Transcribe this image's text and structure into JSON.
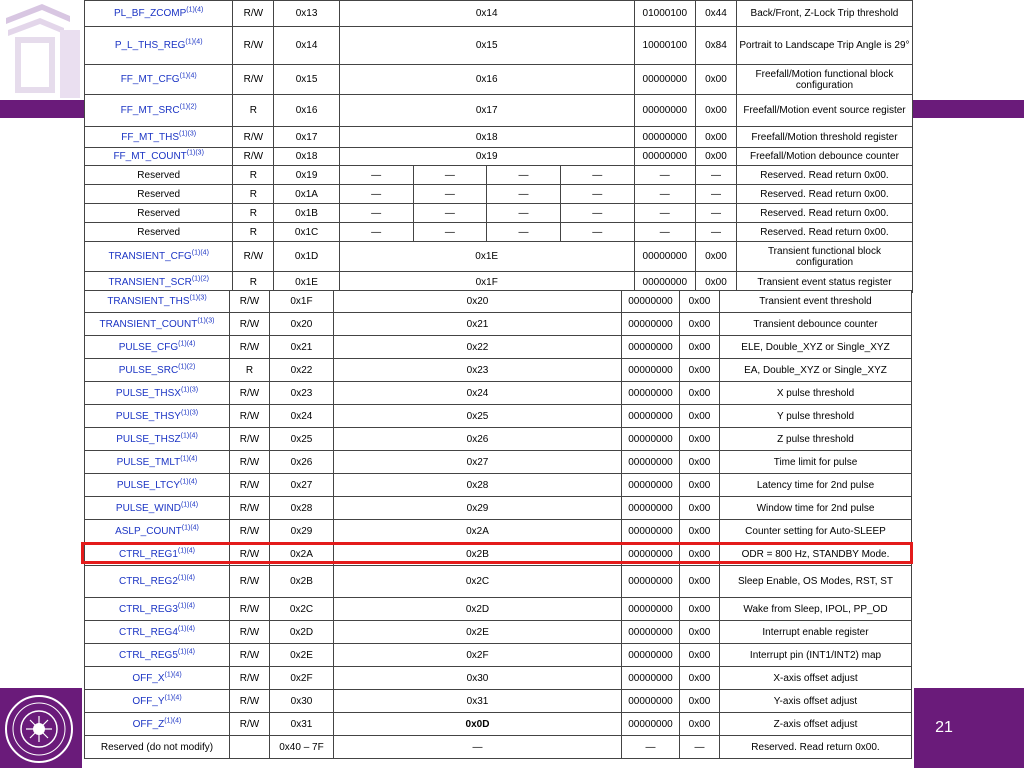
{
  "page_number": "21",
  "table_top": {
    "rows": [
      {
        "name": "PL_BF_ZCOMP",
        "note": "(1)(4)",
        "rw": "R/W",
        "addr": "0x13",
        "auto": [
          "0x14"
        ],
        "default": "01000100",
        "hex": "0x44",
        "comment": "Back/Front, Z-Lock Trip threshold"
      },
      {
        "name": "P_L_THS_REG",
        "note": "(1)(4)",
        "rw": "R/W",
        "addr": "0x14",
        "auto": [
          "0x15"
        ],
        "default": "10000100",
        "hex": "0x84",
        "comment": "Portrait to Landscape Trip Angle is 29°"
      },
      {
        "name": "FF_MT_CFG",
        "note": "(1)(4)",
        "rw": "R/W",
        "addr": "0x15",
        "auto": [
          "0x16"
        ],
        "default": "00000000",
        "hex": "0x00",
        "comment": "Freefall/Motion functional block configuration"
      },
      {
        "name": "FF_MT_SRC",
        "note": "(1)(2)",
        "rw": "R",
        "addr": "0x16",
        "auto": [
          "0x17"
        ],
        "default": "00000000",
        "hex": "0x00",
        "comment": "Freefall/Motion event source register"
      },
      {
        "name": "FF_MT_THS",
        "note": "(1)(3)",
        "rw": "R/W",
        "addr": "0x17",
        "auto": [
          "0x18"
        ],
        "default": "00000000",
        "hex": "0x00",
        "comment": "Freefall/Motion threshold register"
      },
      {
        "name": "FF_MT_COUNT",
        "note": "(1)(3)",
        "rw": "R/W",
        "addr": "0x18",
        "auto": [
          "0x19"
        ],
        "default": "00000000",
        "hex": "0x00",
        "comment": "Freefall/Motion debounce counter"
      },
      {
        "name": "Reserved",
        "note": "",
        "rw": "R",
        "addr": "0x19",
        "auto": [
          "—",
          "—",
          "—",
          "—"
        ],
        "default": "—",
        "hex": "—",
        "comment": "Reserved. Read return 0x00."
      },
      {
        "name": "Reserved",
        "note": "",
        "rw": "R",
        "addr": "0x1A",
        "auto": [
          "—",
          "—",
          "—",
          "—"
        ],
        "default": "—",
        "hex": "—",
        "comment": "Reserved. Read return 0x00."
      },
      {
        "name": "Reserved",
        "note": "",
        "rw": "R",
        "addr": "0x1B",
        "auto": [
          "—",
          "—",
          "—",
          "—"
        ],
        "default": "—",
        "hex": "—",
        "comment": "Reserved. Read return 0x00."
      },
      {
        "name": "Reserved",
        "note": "",
        "rw": "R",
        "addr": "0x1C",
        "auto": [
          "—",
          "—",
          "—",
          "—"
        ],
        "default": "—",
        "hex": "—",
        "comment": "Reserved. Read return 0x00."
      },
      {
        "name": "TRANSIENT_CFG",
        "note": "(1)(4)",
        "rw": "R/W",
        "addr": "0x1D",
        "auto": [
          "0x1E"
        ],
        "default": "00000000",
        "hex": "0x00",
        "comment": "Transient functional block configuration"
      },
      {
        "name": "TRANSIENT_SCR",
        "note": "(1)(2)",
        "rw": "R",
        "addr": "0x1E",
        "auto": [
          "0x1F"
        ],
        "default": "00000000",
        "hex": "0x00",
        "comment": "Transient event status register"
      }
    ]
  },
  "table_bottom": {
    "rows": [
      {
        "name": "TRANSIENT_THS",
        "note": "(1)(3)",
        "rw": "R/W",
        "addr": "0x1F",
        "auto": "0x20",
        "default": "00000000",
        "hex": "0x00",
        "comment": "Transient event threshold"
      },
      {
        "name": "TRANSIENT_COUNT",
        "note": "(1)(3)",
        "rw": "R/W",
        "addr": "0x20",
        "auto": "0x21",
        "default": "00000000",
        "hex": "0x00",
        "comment": "Transient debounce counter"
      },
      {
        "name": "PULSE_CFG",
        "note": "(1)(4)",
        "rw": "R/W",
        "addr": "0x21",
        "auto": "0x22",
        "default": "00000000",
        "hex": "0x00",
        "comment": "ELE, Double_XYZ or Single_XYZ"
      },
      {
        "name": "PULSE_SRC",
        "note": "(1)(2)",
        "rw": "R",
        "addr": "0x22",
        "auto": "0x23",
        "default": "00000000",
        "hex": "0x00",
        "comment": "EA, Double_XYZ or Single_XYZ"
      },
      {
        "name": "PULSE_THSX",
        "note": "(1)(3)",
        "rw": "R/W",
        "addr": "0x23",
        "auto": "0x24",
        "default": "00000000",
        "hex": "0x00",
        "comment": "X pulse threshold"
      },
      {
        "name": "PULSE_THSY",
        "note": "(1)(3)",
        "rw": "R/W",
        "addr": "0x24",
        "auto": "0x25",
        "default": "00000000",
        "hex": "0x00",
        "comment": "Y pulse threshold"
      },
      {
        "name": "PULSE_THSZ",
        "note": "(1)(4)",
        "rw": "R/W",
        "addr": "0x25",
        "auto": "0x26",
        "default": "00000000",
        "hex": "0x00",
        "comment": "Z pulse threshold"
      },
      {
        "name": "PULSE_TMLT",
        "note": "(1)(4)",
        "rw": "R/W",
        "addr": "0x26",
        "auto": "0x27",
        "default": "00000000",
        "hex": "0x00",
        "comment": "Time limit for pulse"
      },
      {
        "name": "PULSE_LTCY",
        "note": "(1)(4)",
        "rw": "R/W",
        "addr": "0x27",
        "auto": "0x28",
        "default": "00000000",
        "hex": "0x00",
        "comment": "Latency time for 2nd pulse"
      },
      {
        "name": "PULSE_WIND",
        "note": "(1)(4)",
        "rw": "R/W",
        "addr": "0x28",
        "auto": "0x29",
        "default": "00000000",
        "hex": "0x00",
        "comment": "Window time for 2nd pulse"
      },
      {
        "name": "ASLP_COUNT",
        "note": "(1)(4)",
        "rw": "R/W",
        "addr": "0x29",
        "auto": "0x2A",
        "default": "00000000",
        "hex": "0x00",
        "comment": "Counter setting for Auto-SLEEP"
      },
      {
        "name": "CTRL_REG1",
        "note": "(1)(4)",
        "rw": "R/W",
        "addr": "0x2A",
        "auto": "0x2B",
        "default": "00000000",
        "hex": "0x00",
        "comment": "ODR = 800 Hz, STANDBY Mode."
      },
      {
        "name": "CTRL_REG2",
        "note": "(1)(4)",
        "rw": "R/W",
        "addr": "0x2B",
        "auto": "0x2C",
        "default": "00000000",
        "hex": "0x00",
        "comment": "Sleep Enable, OS Modes, RST, ST"
      },
      {
        "name": "CTRL_REG3",
        "note": "(1)(4)",
        "rw": "R/W",
        "addr": "0x2C",
        "auto": "0x2D",
        "default": "00000000",
        "hex": "0x00",
        "comment": "Wake from Sleep, IPOL, PP_OD"
      },
      {
        "name": "CTRL_REG4",
        "note": "(1)(4)",
        "rw": "R/W",
        "addr": "0x2D",
        "auto": "0x2E",
        "default": "00000000",
        "hex": "0x00",
        "comment": "Interrupt enable register"
      },
      {
        "name": "CTRL_REG5",
        "note": "(1)(4)",
        "rw": "R/W",
        "addr": "0x2E",
        "auto": "0x2F",
        "default": "00000000",
        "hex": "0x00",
        "comment": "Interrupt pin (INT1/INT2) map"
      },
      {
        "name": "OFF_X",
        "note": "(1)(4)",
        "rw": "R/W",
        "addr": "0x2F",
        "auto": "0x30",
        "default": "00000000",
        "hex": "0x00",
        "comment": "X-axis offset adjust"
      },
      {
        "name": "OFF_Y",
        "note": "(1)(4)",
        "rw": "R/W",
        "addr": "0x30",
        "auto": "0x31",
        "default": "00000000",
        "hex": "0x00",
        "comment": "Y-axis offset adjust"
      },
      {
        "name": "OFF_Z",
        "note": "(1)(4)",
        "rw": "R/W",
        "addr": "0x31",
        "auto": "0x0D",
        "default": "00000000",
        "hex": "0x00",
        "comment": "Z-axis offset adjust"
      },
      {
        "name": "Reserved (do not modify)",
        "note": "",
        "rw": "",
        "addr": "0x40 – 7F",
        "auto": "—",
        "default": "—",
        "hex": "—",
        "comment": "Reserved. Read return 0x00."
      }
    ]
  },
  "colors": {
    "accent": "#6a1b7a",
    "link": "#1b34c4",
    "highlight": "#e31b1b"
  },
  "icons": {
    "top_logo": "university-logo-icon",
    "seal": "university-seal-icon"
  }
}
